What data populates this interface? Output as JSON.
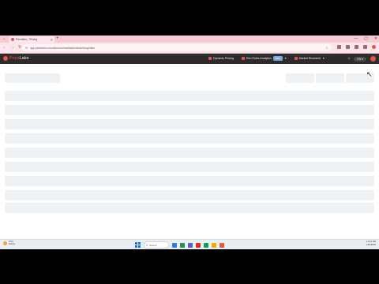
{
  "browser": {
    "tab_title": "Pricelabs - Pricing",
    "address_url": "app.pricelabs.co/customers/multicalendar/pricing/rules",
    "new_tab_label": "+",
    "window_controls": [
      "—",
      "▢",
      "✕"
    ]
  },
  "app": {
    "brand_prefix": "Price",
    "brand_suffix": "Labs",
    "nav": [
      {
        "label": "Dynamic Pricing",
        "icon": "tag-icon",
        "color": "#e0574b"
      },
      {
        "label": "Rev Rules Analytics",
        "badge": "Beta",
        "icon": "chart-icon",
        "color": "#e0574b"
      },
      {
        "label": "Market Research",
        "icon": "grid-icon",
        "color": "#e0574b"
      }
    ],
    "help_icon": "help-icon",
    "language": "EN"
  },
  "taskbar": {
    "weather_temp": "75°F",
    "weather_desc": "Sunny",
    "search_placeholder": "Search",
    "time": "12:51 PM",
    "date": "1/24/2024",
    "app_colors": [
      "#3a7bd5",
      "#2d8c5a",
      "#5b5fc7",
      "#d93025",
      "#0f9d58",
      "#f2a900",
      "#e0574b"
    ]
  },
  "colors": {
    "header_bg": "#2e2b2c",
    "accent": "#e0574b",
    "skeleton": "#eef2f5",
    "tab_strip": "#f6c9d3"
  }
}
